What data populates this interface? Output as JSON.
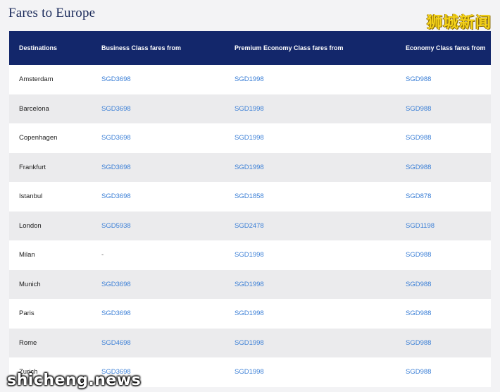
{
  "page": {
    "title": "Fares to Europe"
  },
  "watermarks": {
    "top_right": "狮城新闻",
    "bottom_left": "shicheng.news"
  },
  "table": {
    "headers": {
      "destinations": "Destinations",
      "business": "Business Class fares from",
      "premium": "Premium Economy Class fares from",
      "economy": "Economy Class fares from"
    },
    "rows": [
      {
        "destination": "Amsterdam",
        "business": "SGD3698",
        "premium": "SGD1998",
        "economy": "SGD988"
      },
      {
        "destination": "Barcelona",
        "business": "SGD3698",
        "premium": "SGD1998",
        "economy": "SGD988"
      },
      {
        "destination": "Copenhagen",
        "business": "SGD3698",
        "premium": "SGD1998",
        "economy": "SGD988"
      },
      {
        "destination": "Frankfurt",
        "business": "SGD3698",
        "premium": "SGD1998",
        "economy": "SGD988"
      },
      {
        "destination": "Istanbul",
        "business": "SGD3698",
        "premium": "SGD1858",
        "economy": "SGD878"
      },
      {
        "destination": "London",
        "business": "SGD5938",
        "premium": "SGD2478",
        "economy": "SGD1198"
      },
      {
        "destination": "Milan",
        "business": "-",
        "premium": "SGD1998",
        "economy": "SGD988"
      },
      {
        "destination": "Munich",
        "business": "SGD3698",
        "premium": "SGD1998",
        "economy": "SGD988"
      },
      {
        "destination": "Paris",
        "business": "SGD3698",
        "premium": "SGD1998",
        "economy": "SGD988"
      },
      {
        "destination": "Rome",
        "business": "SGD4698",
        "premium": "SGD1998",
        "economy": "SGD988"
      },
      {
        "destination": "Zurich",
        "business": "SGD3698",
        "premium": "SGD1998",
        "economy": "SGD988"
      }
    ]
  },
  "colors": {
    "header_bg": "#13276b",
    "link": "#3b7fd6",
    "row_alt": "#ebebed"
  }
}
